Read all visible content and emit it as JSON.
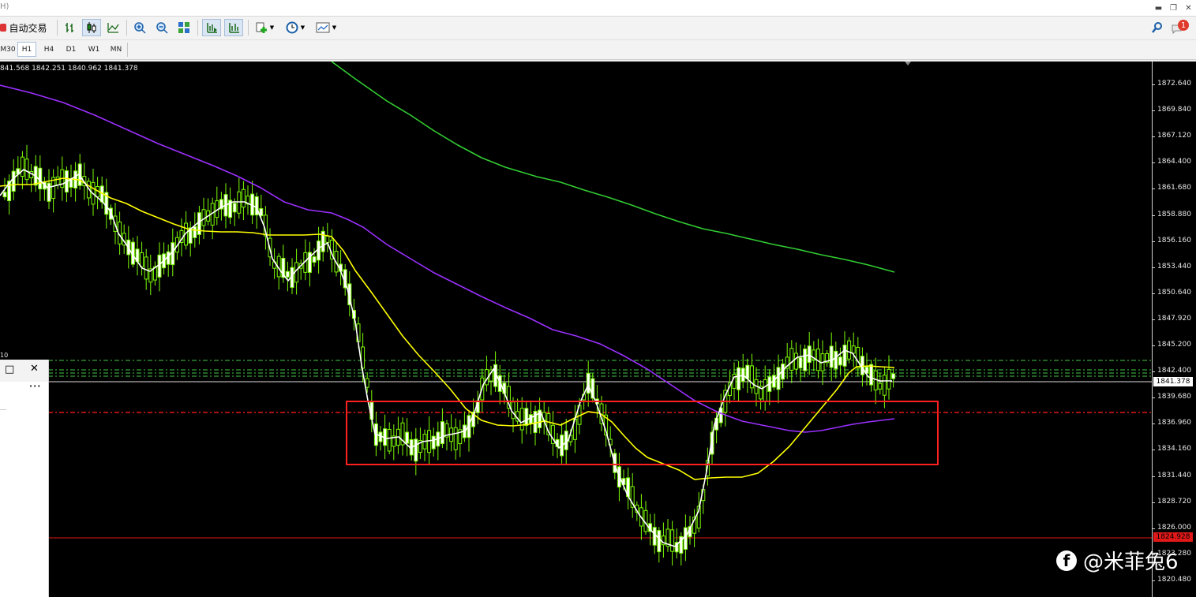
{
  "titlebar": {
    "title": "H)"
  },
  "toolbar": {
    "autotrade_label": "自动交易"
  },
  "timeframes": [
    {
      "label": "M30",
      "selected": false
    },
    {
      "label": "H1",
      "selected": true
    },
    {
      "label": "H4",
      "selected": false
    },
    {
      "label": "D1",
      "selected": false
    },
    {
      "label": "W1",
      "selected": false
    },
    {
      "label": "MN",
      "selected": false
    }
  ],
  "chart": {
    "ohlc_text": "841.568 1842.251 1840.962 1841.378",
    "price_axis": [
      "1872.640",
      "1869.840",
      "1867.120",
      "1864.400",
      "1861.680",
      "1858.880",
      "1856.160",
      "1853.440",
      "1850.640",
      "1847.920",
      "1845.200",
      "1842.400",
      "1839.680",
      "1836.960",
      "1834.160",
      "1831.440",
      "1828.720",
      "1826.000",
      "1823.280",
      "1820.480"
    ],
    "current_price": "1841.378",
    "red_line_price": "1824.928",
    "left_label": "10",
    "notification_count": "1",
    "colors": {
      "up_candle": "#ffffff",
      "down_candle": "#7cfc00",
      "ma_white": "#ffffff",
      "ma_yellow": "#ffff00",
      "ma_purple": "#9b30ff",
      "ma_green": "#32cd32",
      "box": "#ff2020"
    }
  },
  "panel": {
    "close_glyph": "✕",
    "restore_glyph": "□",
    "more_glyph": "•••"
  },
  "watermark": {
    "handle": "@米菲兔6"
  }
}
